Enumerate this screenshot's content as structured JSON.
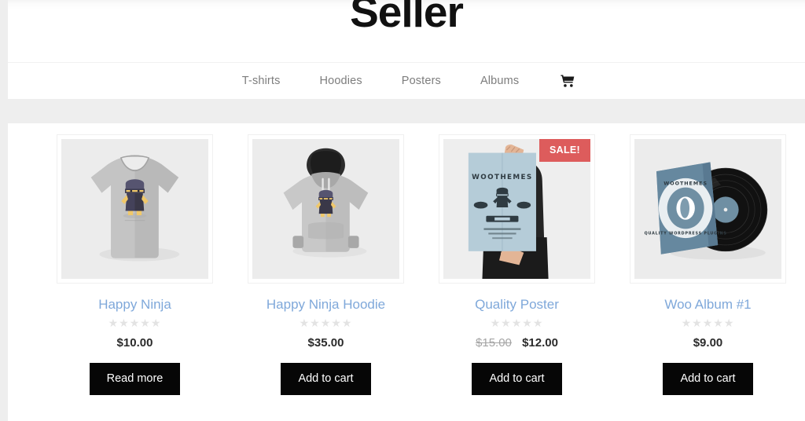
{
  "site": {
    "title": "Seller"
  },
  "nav": {
    "items": [
      {
        "label": "T-shirts"
      },
      {
        "label": "Hoodies"
      },
      {
        "label": "Posters"
      },
      {
        "label": "Albums"
      }
    ],
    "cart_icon": "shopping-cart-icon"
  },
  "shop": {
    "rating_stars": "★★★★★",
    "products": [
      {
        "title": "Happy Ninja",
        "price": "$10.00",
        "price_old": "",
        "on_sale": false,
        "sale_label": "",
        "button_label": "Read more",
        "image_name": "happy-ninja-tshirt-photo"
      },
      {
        "title": "Happy Ninja Hoodie",
        "price": "$35.00",
        "price_old": "",
        "on_sale": false,
        "sale_label": "",
        "button_label": "Add to cart",
        "image_name": "happy-ninja-hoodie-photo"
      },
      {
        "title": "Quality Poster",
        "price": "$12.00",
        "price_old": "$15.00",
        "on_sale": true,
        "sale_label": "SALE!",
        "button_label": "Add to cart",
        "image_name": "quality-poster-photo"
      },
      {
        "title": "Woo Album #1",
        "price": "$9.00",
        "price_old": "",
        "on_sale": false,
        "sale_label": "",
        "button_label": "Add to cart",
        "image_name": "woo-album-vinyl-photo"
      }
    ]
  },
  "colors": {
    "page_bg": "#eeeeee",
    "content_bg": "#ffffff",
    "link": "#7fa8da",
    "sale_badge": "#dd5c5c",
    "button_bg": "#060606",
    "star_empty": "#e3e3e3"
  }
}
